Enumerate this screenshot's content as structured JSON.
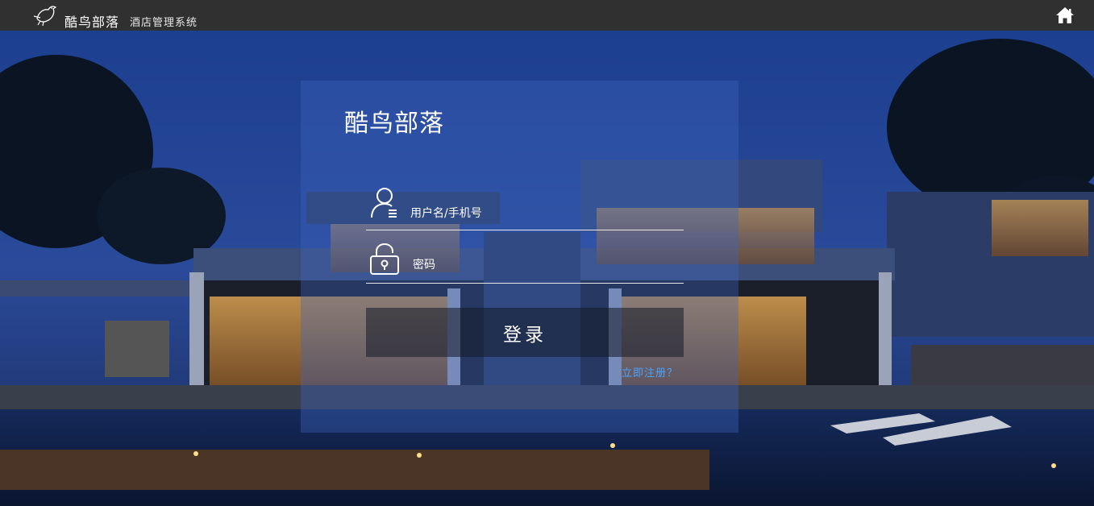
{
  "header": {
    "brand": "酷鸟部落",
    "subtitle": "酒店管理系统",
    "logo_icon": "bird-logo-icon",
    "home_icon": "home-icon"
  },
  "login": {
    "title": "酷鸟部落",
    "username_placeholder": "用户名/手机号",
    "password_placeholder": "密码",
    "submit_label": "登录",
    "register_link": "立即注册？"
  },
  "colors": {
    "topbar": "#303030",
    "link": "#4aa3ff",
    "panel_tint": "#3c64be"
  }
}
